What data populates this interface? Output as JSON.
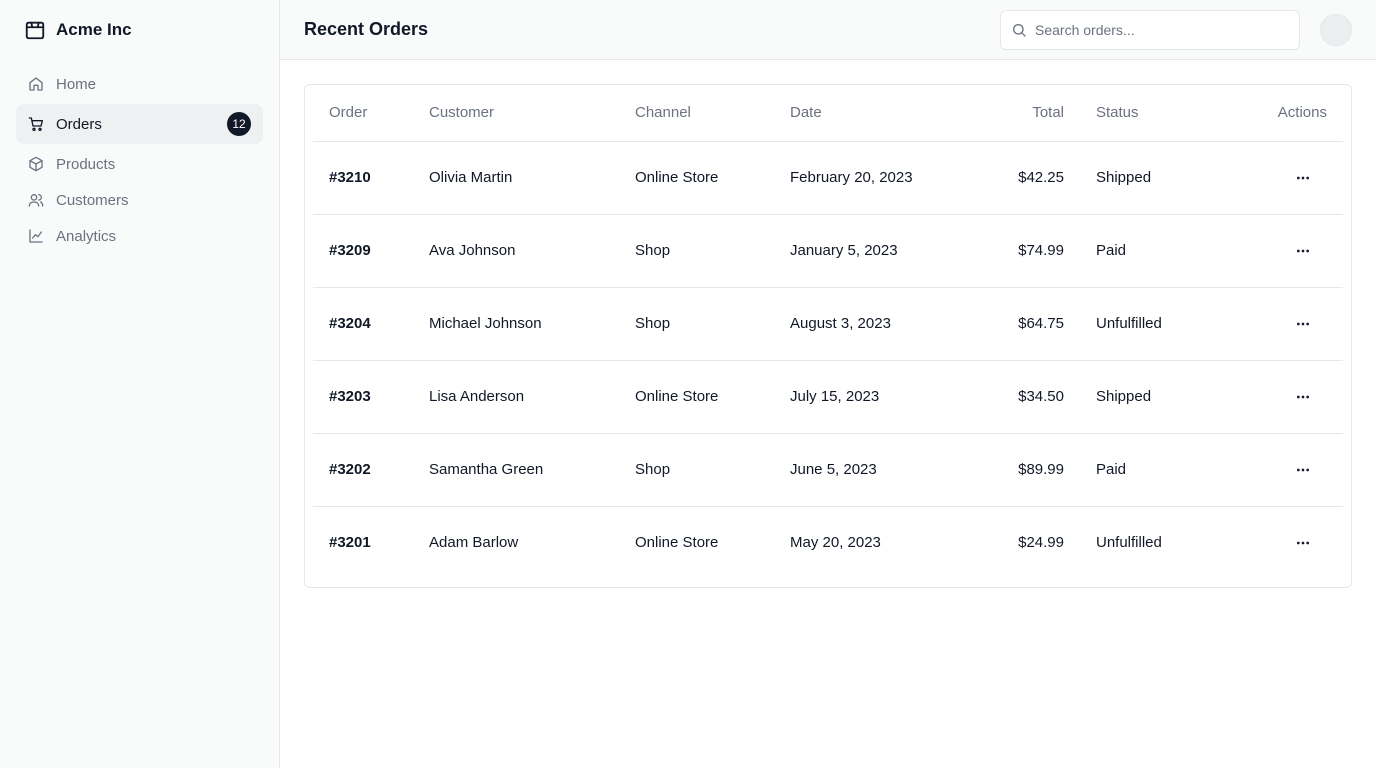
{
  "brand": {
    "name": "Acme Inc",
    "icon": "package-icon"
  },
  "sidebar": {
    "items": [
      {
        "label": "Home",
        "icon": "home-icon",
        "active": false
      },
      {
        "label": "Orders",
        "icon": "cart-icon",
        "active": true,
        "badge": "12"
      },
      {
        "label": "Products",
        "icon": "box-icon",
        "active": false
      },
      {
        "label": "Customers",
        "icon": "users-icon",
        "active": false
      },
      {
        "label": "Analytics",
        "icon": "chart-line-icon",
        "active": false
      }
    ]
  },
  "header": {
    "title": "Recent Orders",
    "search_placeholder": "Search orders..."
  },
  "table": {
    "columns": [
      "Order",
      "Customer",
      "Channel",
      "Date",
      "Total",
      "Status",
      "Actions"
    ],
    "rows": [
      {
        "order": "#3210",
        "customer": "Olivia Martin",
        "channel": "Online Store",
        "date": "February 20, 2023",
        "total": "$42.25",
        "status": "Shipped"
      },
      {
        "order": "#3209",
        "customer": "Ava Johnson",
        "channel": "Shop",
        "date": "January 5, 2023",
        "total": "$74.99",
        "status": "Paid"
      },
      {
        "order": "#3204",
        "customer": "Michael Johnson",
        "channel": "Shop",
        "date": "August 3, 2023",
        "total": "$64.75",
        "status": "Unfulfilled"
      },
      {
        "order": "#3203",
        "customer": "Lisa Anderson",
        "channel": "Online Store",
        "date": "July 15, 2023",
        "total": "$34.50",
        "status": "Shipped"
      },
      {
        "order": "#3202",
        "customer": "Samantha Green",
        "channel": "Shop",
        "date": "June 5, 2023",
        "total": "$89.99",
        "status": "Paid"
      },
      {
        "order": "#3201",
        "customer": "Adam Barlow",
        "channel": "Online Store",
        "date": "May 20, 2023",
        "total": "$24.99",
        "status": "Unfulfilled"
      }
    ]
  }
}
